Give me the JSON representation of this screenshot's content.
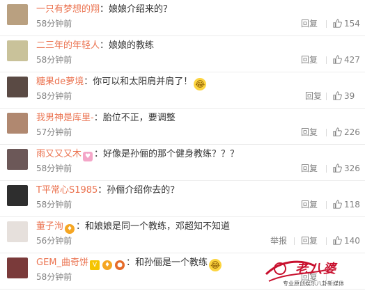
{
  "comments": [
    {
      "username": "一只有梦想的翔",
      "text": "娘娘介绍来的？",
      "time": "58分钟前",
      "reply": "回复",
      "likes": "154",
      "avatar_color": "#b9a080"
    },
    {
      "username": "二三年的年轻人",
      "text": "娘娘的教练",
      "time": "58分钟前",
      "reply": "回复",
      "likes": "427",
      "avatar_color": "#c9c29a"
    },
    {
      "username": "糖果de萝境",
      "text": "你可以和太阳肩并肩了！",
      "emoji": "😂",
      "time": "58分钟前",
      "reply": "回复",
      "likes": "39",
      "avatar_color": "#5a4a44"
    },
    {
      "username": "我男神是库里-",
      "text": "胎位不正，要调整",
      "time": "57分钟前",
      "reply": "回复",
      "likes": "226",
      "avatar_color": "#b08870"
    },
    {
      "username": "雨又又又木",
      "text": "好像是孙俪的那个健身教练？？？",
      "time": "58分钟前",
      "reply": "回复",
      "likes": "326",
      "avatar_color": "#6c5858"
    },
    {
      "username": "T平常心S1985",
      "text": "孙俪介绍你去的？",
      "time": "58分钟前",
      "reply": "回复",
      "likes": "118",
      "avatar_color": "#2e2e2e"
    },
    {
      "username": "董子洵",
      "text": "和娘娘是同一个教练，邓超知不知道",
      "time": "56分钟前",
      "report": "举报",
      "reply": "回复",
      "likes": "140",
      "avatar_color": "#e6e0dc"
    },
    {
      "username": "GEM_曲奇饼",
      "text": "和孙俪是一个教练",
      "emoji": "😂",
      "time": "58分钟前",
      "reply": "回复",
      "likes": "",
      "avatar_color": "#7a3a3a"
    }
  ],
  "icons": {
    "like": "thumbs-up-icon",
    "emoji": "laughing-emoji-icon",
    "vip": "vip-badge-icon"
  },
  "accent_color": "#eb7350",
  "watermark": {
    "brand": "老八婆",
    "sub": "专业原创娱乐八卦新媒体"
  }
}
